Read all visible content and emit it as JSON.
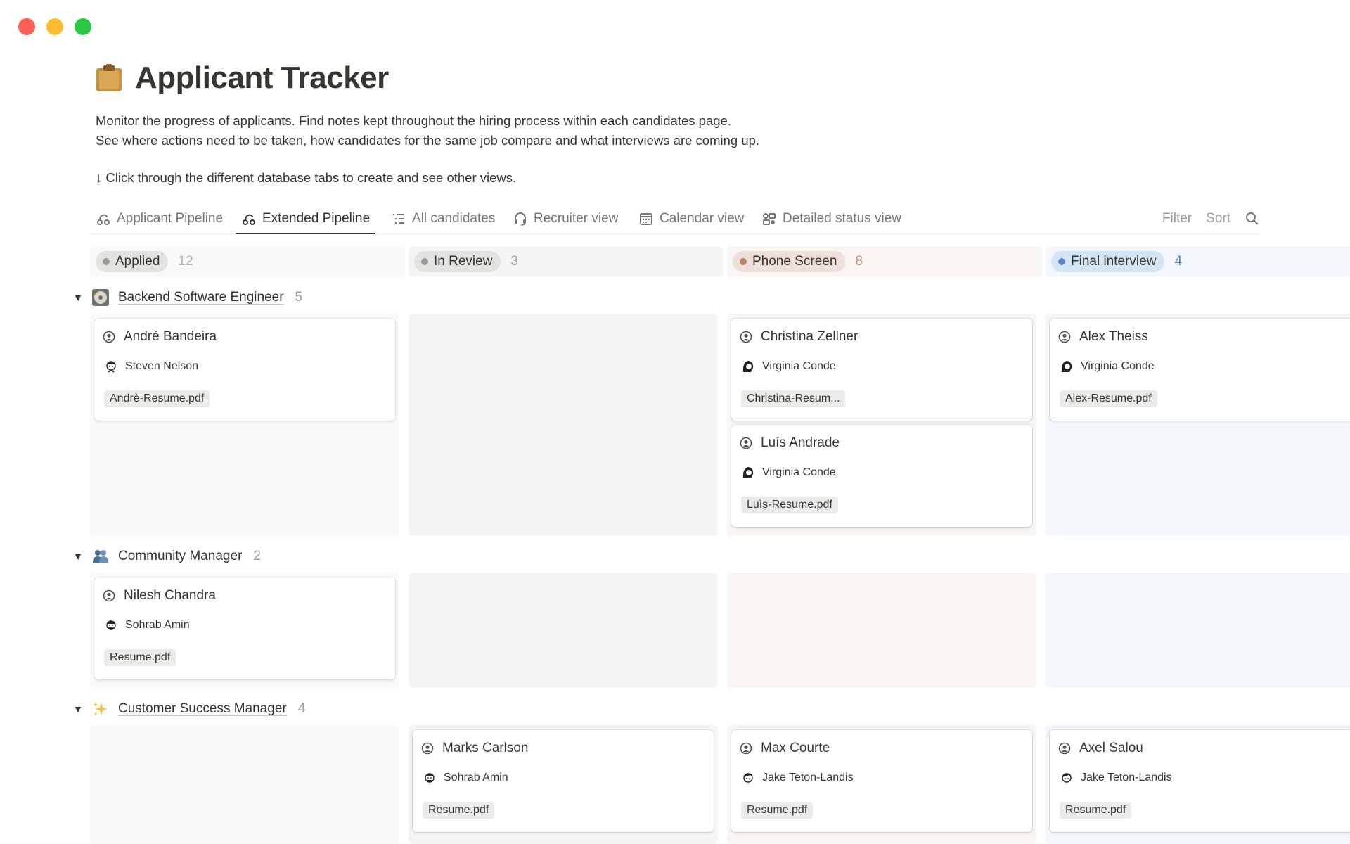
{
  "page": {
    "title": "Applicant Tracker",
    "icon": "clipboard-icon",
    "description_line1": "Monitor the progress of applicants. Find notes kept throughout the hiring process within each candidates page.",
    "description_line2": "See where actions need to be taken, how candidates for the same job compare and what interviews are coming up.",
    "hint": "↓ Click through the different database tabs to create and see other views."
  },
  "tabs": [
    {
      "label": "Applicant Pipeline",
      "icon": "pipeline-icon"
    },
    {
      "label": "Extended Pipeline",
      "icon": "pipeline-icon",
      "active": true
    },
    {
      "label": "All candidates",
      "icon": "list-icon"
    },
    {
      "label": "Recruiter view",
      "icon": "headset-icon"
    },
    {
      "label": "Calendar view",
      "icon": "calendar-icon"
    },
    {
      "label": "Detailed status view",
      "icon": "status-board-icon"
    }
  ],
  "toolbar": {
    "filter": "Filter",
    "sort": "Sort",
    "search_icon": "search-icon"
  },
  "columns": [
    {
      "label": "Applied",
      "count": "12",
      "color": "#9b9a97",
      "pill_bg": "#e3e2e0",
      "col_bg": "#f9f9f8",
      "count_color": "#b0afac"
    },
    {
      "label": "In Review",
      "count": "3",
      "color": "#9b9a97",
      "pill_bg": "#e3e2e0",
      "col_bg": "#f5f5f4",
      "count_color": "#9b9a97"
    },
    {
      "label": "Phone Screen",
      "count": "8",
      "color": "#c08568",
      "pill_bg": "#eddfd9",
      "col_bg": "#f9f5f3",
      "count_color": "#b9866b"
    },
    {
      "label": "Final interview",
      "count": "4",
      "color": "#5e87c9",
      "pill_bg": "#d3e5f4",
      "col_bg": "#f3f7fb",
      "count_color": "#4f7fb8"
    }
  ],
  "groups": [
    {
      "name": "Backend Software Engineer",
      "count": "5",
      "emoji": "cd-icon",
      "cards": [
        {
          "name": "André Bandeira",
          "recruiter": "Steven Nelson",
          "file": "Andrè-Resume.pdf"
        },
        {
          "name": "Christina Zellner",
          "recruiter": "Virginia Conde",
          "file": "Christina-Resum..."
        },
        {
          "name": "Luís Andrade",
          "recruiter": "Virginia Conde",
          "file": "Luìs-Resume.pdf"
        },
        {
          "name": "Alex Theiss",
          "recruiter": "Virginia Conde",
          "file": "Alex-Resume.pdf"
        }
      ]
    },
    {
      "name": "Community Manager",
      "count": "2",
      "emoji": "people-icon",
      "cards": [
        {
          "name": "Nilesh Chandra",
          "recruiter": "Sohrab Amin",
          "file": "Resume.pdf"
        }
      ]
    },
    {
      "name": "Customer Success Manager",
      "count": "4",
      "emoji": "sparkles-icon",
      "cards": [
        {
          "name": "Marks Carlson",
          "recruiter": "Sohrab Amin",
          "file": "Resume.pdf"
        },
        {
          "name": "Max Courte",
          "recruiter": "Jake Teton-Landis",
          "file": "Resume.pdf"
        },
        {
          "name": "Axel Salou",
          "recruiter": "Jake Teton-Landis",
          "file": "Resume.pdf"
        }
      ]
    }
  ]
}
